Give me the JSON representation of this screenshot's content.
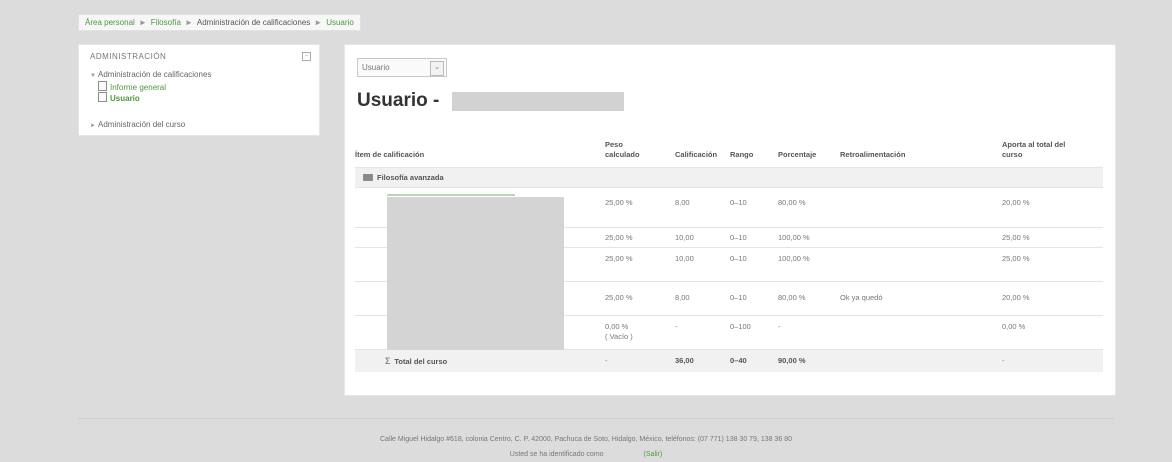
{
  "breadcrumb": {
    "items": [
      "Área personal",
      "Filosofía",
      "Administración de calificaciones",
      "Usuario"
    ],
    "sep": "►"
  },
  "admin_block": {
    "title": "ADMINISTRACIÓN",
    "collapse": "−",
    "section1": "Administración de calificaciones",
    "link1": "Informe general",
    "link2": "Usuario",
    "section2": "Administración del curso",
    "tri_open": "▼",
    "tri_closed": "►"
  },
  "report_select": {
    "value": "Usuario",
    "arrow": "⌄"
  },
  "page_title": "Usuario -",
  "table": {
    "headers": {
      "item": "Ítem de calificación",
      "weight": "Peso\ncalculado",
      "grade": "Calificación",
      "range": "Rango",
      "percent": "Porcentaje",
      "feedback": "Retroalimentación",
      "contrib": "Aporta al total del\ncurso"
    },
    "category": "Filosofía avanzada",
    "rows": [
      {
        "weight": "25,00 %",
        "grade": "8,00",
        "range": "0–10",
        "percent": "80,00 %",
        "feedback": "",
        "contrib": "20,00 %"
      },
      {
        "weight": "25,00 %",
        "grade": "10,00",
        "range": "0–10",
        "percent": "100,00 %",
        "feedback": "",
        "contrib": "25,00 %"
      },
      {
        "weight": "25,00 %",
        "grade": "10,00",
        "range": "0–10",
        "percent": "100,00 %",
        "feedback": "",
        "contrib": "25,00 %"
      },
      {
        "weight": "25,00 %",
        "grade": "8,00",
        "range": "0–10",
        "percent": "80,00 %",
        "feedback": "Ok ya quedó",
        "contrib": "20,00 %"
      },
      {
        "weight": "0,00 %",
        "weight2": "( Vacío )",
        "grade": "-",
        "range": "0–100",
        "percent": "-",
        "feedback": "",
        "contrib": "0,00 %"
      }
    ],
    "total": {
      "label": "Total del curso",
      "weight": "-",
      "grade": "36,00",
      "range": "0–40",
      "percent": "90,00 %",
      "contrib": "-"
    }
  },
  "footer": {
    "address": "Calle Miguel Hidalgo #618, colonia Centro, C. P. 42000, Pachuca de Soto, Hidalgo, México, teléfonos: (07 771) 138 30 79, 138 36 80",
    "login": "Usted se ha identificado como",
    "logout": "(Salir)"
  }
}
